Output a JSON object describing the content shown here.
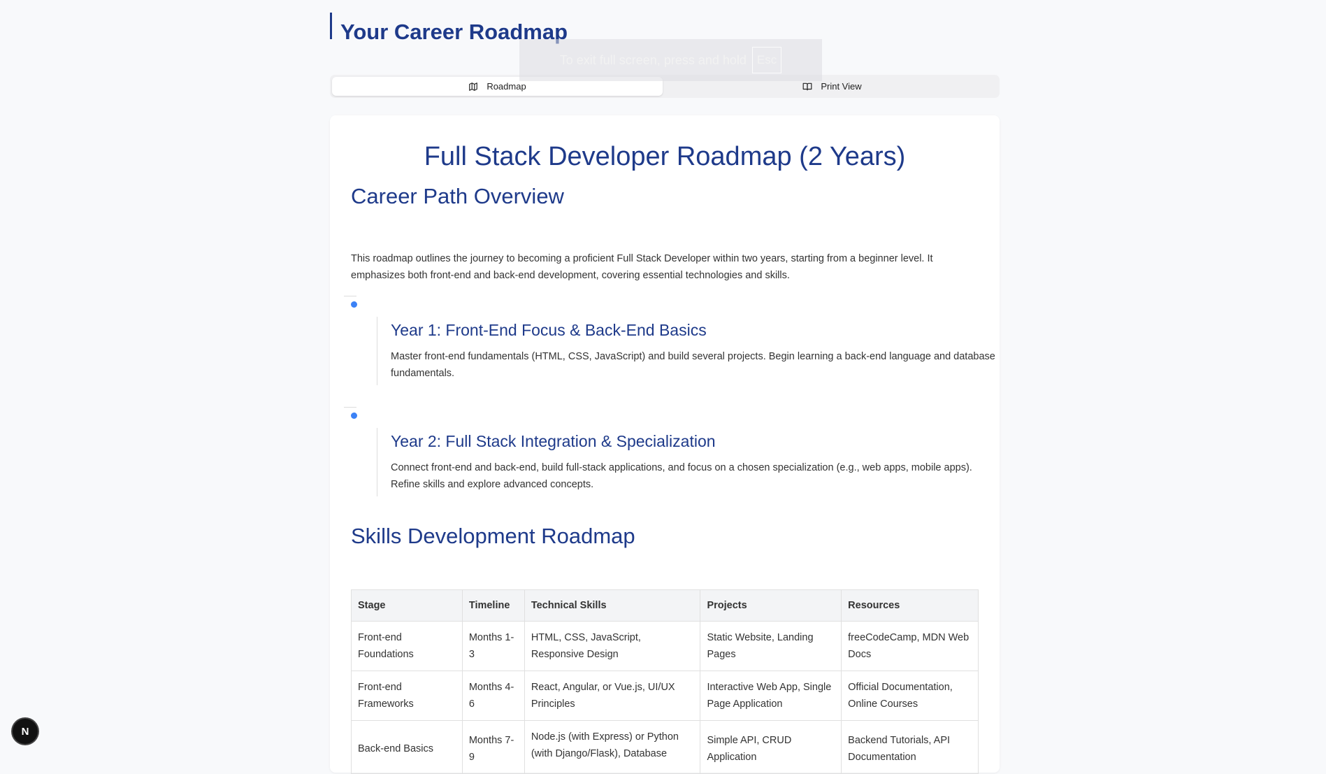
{
  "header": {
    "title": "Your Career Roadmap"
  },
  "fullscreen_toast": {
    "text": "To exit full screen, press and hold",
    "key": "Esc"
  },
  "tabs": [
    {
      "label": "Roadmap",
      "icon": "map-icon",
      "active": true
    },
    {
      "label": "Print View",
      "icon": "book-open-icon",
      "active": false
    }
  ],
  "roadmap": {
    "title": "Full Stack Developer Roadmap (2 Years)",
    "overview": {
      "heading": "Career Path Overview",
      "text": "This roadmap outlines the journey to becoming a proficient Full Stack Developer within two years, starting from a beginner level. It emphasizes both front-end and back-end development, covering essential technologies and skills."
    },
    "milestones": [
      {
        "title": "Year 1: Front-End Focus & Back-End Basics",
        "text": "Master front-end fundamentals (HTML, CSS, JavaScript) and build several projects. Begin learning a back-end language and database fundamentals."
      },
      {
        "title": "Year 2: Full Stack Integration & Specialization",
        "text": "Connect front-end and back-end, build full-stack applications, and focus on a chosen specialization (e.g., web apps, mobile apps). Refine skills and explore advanced concepts."
      }
    ],
    "skills": {
      "heading": "Skills Development Roadmap",
      "columns": [
        "Stage",
        "Timeline",
        "Technical Skills",
        "Projects",
        "Resources"
      ],
      "rows": [
        [
          "Front-end Foundations",
          "Months 1-3",
          "HTML, CSS, JavaScript, Responsive Design",
          "Static Website, Landing Pages",
          "freeCodeCamp, MDN Web Docs"
        ],
        [
          "Front-end Frameworks",
          "Months 4-6",
          "React, Angular, or Vue.js, UI/UX Principles",
          "Interactive Web App, Single Page Application",
          "Official Documentation, Online Courses"
        ],
        [
          "Back-end Basics",
          "Months 7-9",
          "Node.js (with Express) or Python (with Django/Flask), Database",
          "Simple API, CRUD Application",
          "Backend Tutorials, API Documentation"
        ]
      ]
    }
  },
  "dev_badge": {
    "label": "N"
  },
  "colors": {
    "accent": "#1e3a8a",
    "dot": "#3b82f6"
  }
}
